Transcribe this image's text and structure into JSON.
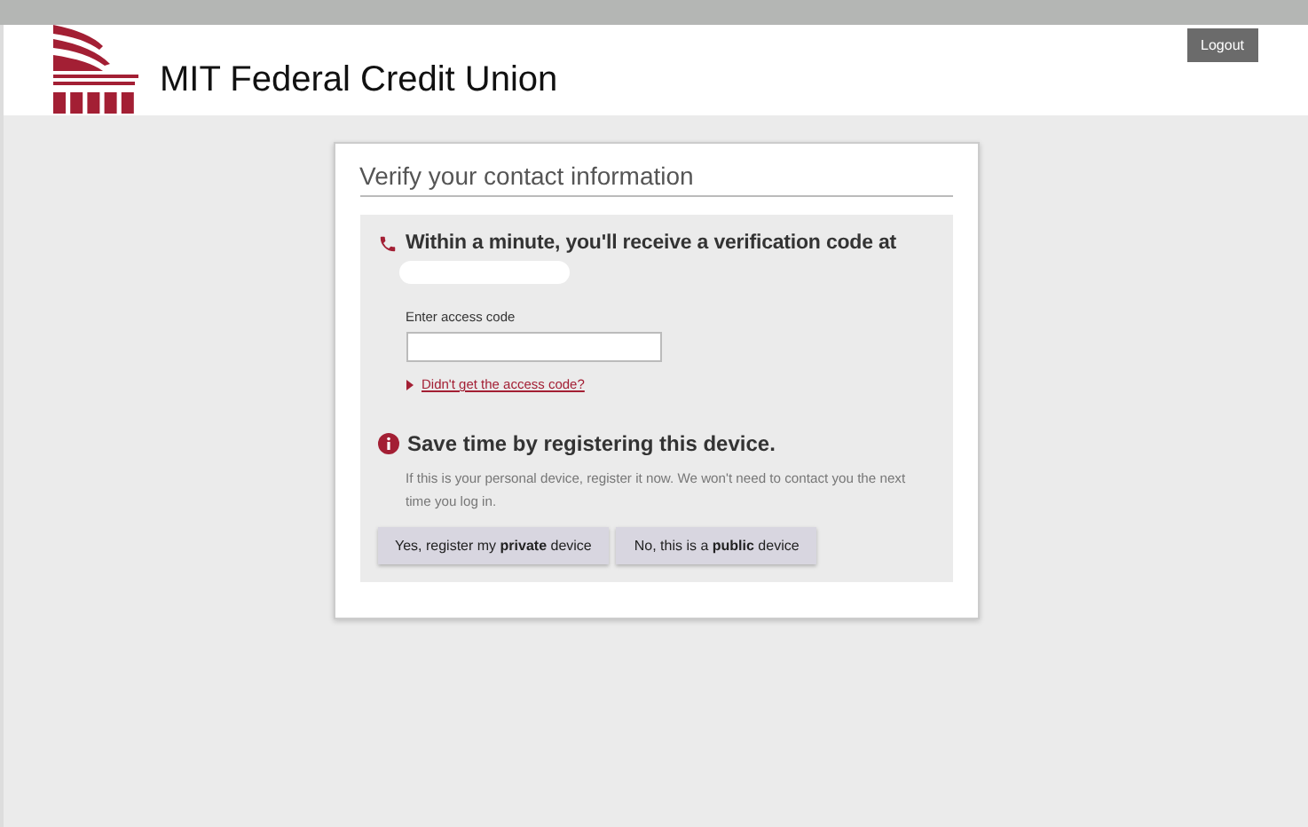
{
  "header": {
    "brand": "MIT Federal Credit Union",
    "logout": "Logout"
  },
  "card": {
    "title": "Verify your contact information",
    "notice": "Within a minute, you'll receive a verification code at",
    "field": {
      "label": "Enter access code"
    },
    "help_link": "Didn't get the access code?",
    "register": {
      "heading": "Save time by registering this device.",
      "text": "If this is your personal device, register it now. We won't need to contact you the next time you log in.",
      "buttons": [
        "Yes, register my **private** device",
        "No, this is a **public** device"
      ]
    }
  }
}
